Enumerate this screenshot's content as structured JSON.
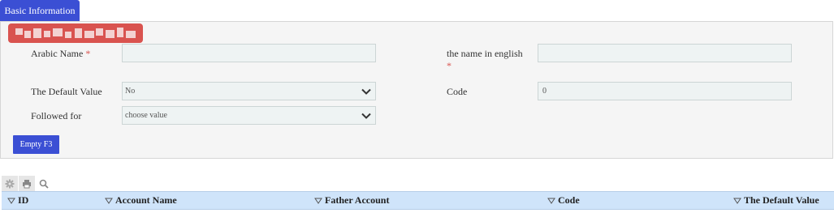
{
  "tab": {
    "label": "Basic Information"
  },
  "form": {
    "arabic_name": {
      "label": "Arabic Name",
      "required_mark": "*",
      "value": ""
    },
    "english_name": {
      "label": "the name in english",
      "required_mark": "*",
      "value": ""
    },
    "default_value": {
      "label": "The Default Value",
      "selected": "No"
    },
    "code": {
      "label": "Code",
      "value": "0"
    },
    "followed_for": {
      "label": "Followed for",
      "selected": "choose value"
    }
  },
  "buttons": {
    "empty": "Empty F3"
  },
  "toolbar": [
    "gear-icon",
    "print-icon",
    "search-icon"
  ],
  "grid": {
    "columns": [
      "ID",
      "Account Name",
      "Father Account",
      "Code",
      "The Default Value"
    ]
  },
  "colors": {
    "accent": "#3b4fd4",
    "badge": "#d9534f",
    "header": "#cfe4fa"
  }
}
